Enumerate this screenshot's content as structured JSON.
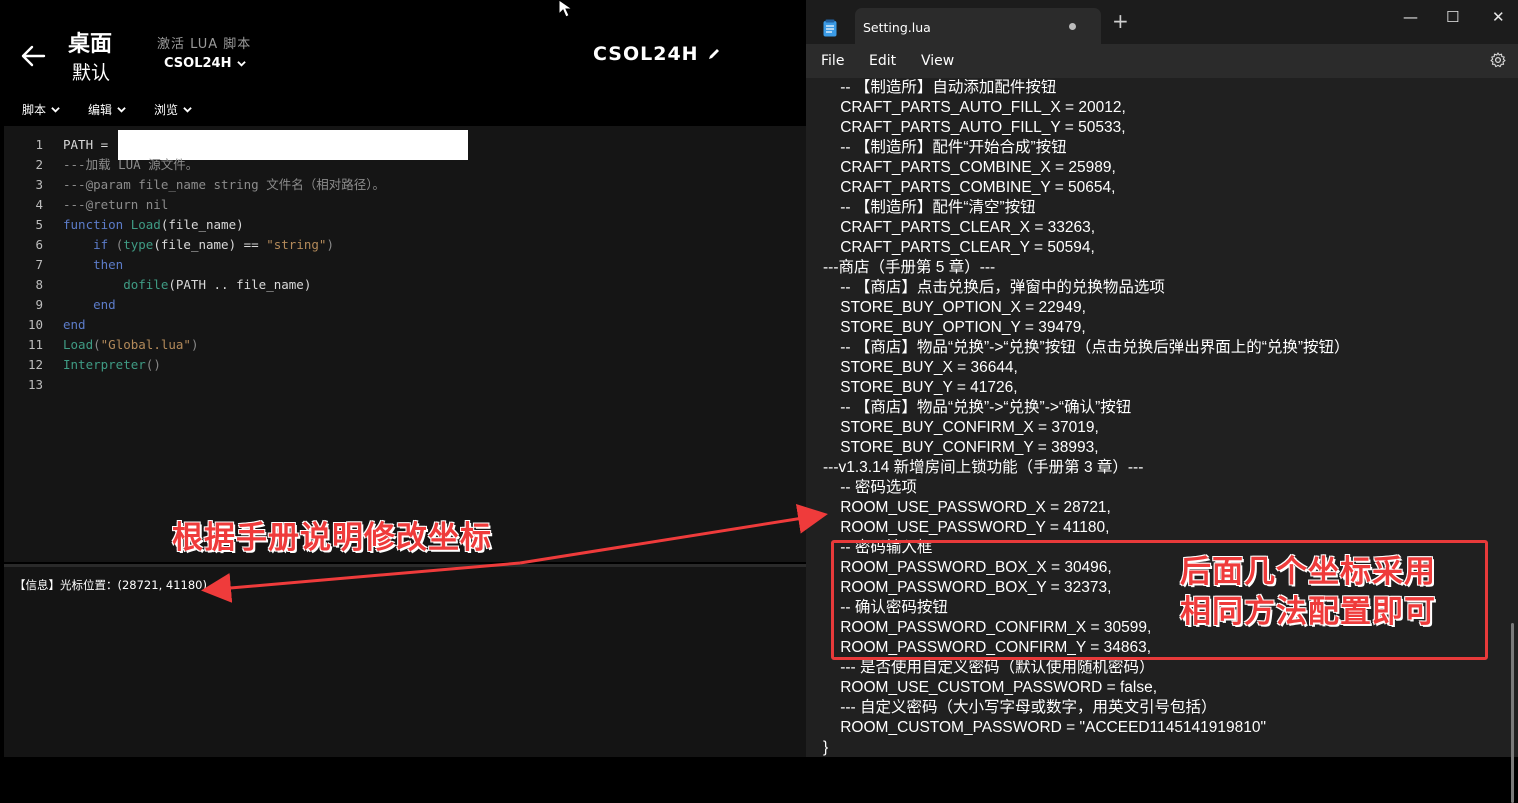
{
  "left_app": {
    "title_main": "桌面",
    "title_sub": "默认",
    "activate_label": "激活 LUA 脚本",
    "script_name": "CSOL24H",
    "center_title": "CSOL24H",
    "menus": [
      "脚本",
      "编辑",
      "浏览"
    ],
    "editor": {
      "line_numbers": [
        "1",
        "2",
        "3",
        "4",
        "5",
        "6",
        "7",
        "8",
        "9",
        "10",
        "11",
        "12",
        "13"
      ],
      "lines": [
        {
          "parts": [
            {
              "t": "PATH = ",
              "c": "plain"
            }
          ]
        },
        {
          "parts": [
            {
              "t": "---加载 LUA 源文件。",
              "c": "cm"
            }
          ]
        },
        {
          "parts": [
            {
              "t": "---@param file_name string 文件名（相对路径）。",
              "c": "cm"
            }
          ]
        },
        {
          "parts": [
            {
              "t": "---@return nil",
              "c": "cm"
            }
          ]
        },
        {
          "parts": [
            {
              "t": "function ",
              "c": "kw"
            },
            {
              "t": "Load",
              "c": "fn"
            },
            {
              "t": "(file_name)",
              "c": "plain"
            }
          ]
        },
        {
          "parts": [
            {
              "t": "    if ",
              "c": "kw"
            },
            {
              "t": "(",
              "c": "dim"
            },
            {
              "t": "type",
              "c": "fn"
            },
            {
              "t": "(file_name) == ",
              "c": "plain"
            },
            {
              "t": "\"string\"",
              "c": "str"
            },
            {
              "t": ")",
              "c": "dim"
            }
          ]
        },
        {
          "parts": [
            {
              "t": "    then",
              "c": "kw"
            }
          ]
        },
        {
          "parts": [
            {
              "t": "        dofile",
              "c": "fn"
            },
            {
              "t": "(PATH .. file_name)",
              "c": "plain"
            }
          ]
        },
        {
          "parts": [
            {
              "t": "    end",
              "c": "kw"
            }
          ]
        },
        {
          "parts": [
            {
              "t": "end",
              "c": "kw"
            }
          ]
        },
        {
          "parts": [
            {
              "t": "Load",
              "c": "fn"
            },
            {
              "t": "(",
              "c": "dim"
            },
            {
              "t": "\"Global.lua\"",
              "c": "str"
            },
            {
              "t": ")",
              "c": "dim"
            }
          ]
        },
        {
          "parts": [
            {
              "t": "Interpreter",
              "c": "fn"
            },
            {
              "t": "()",
              "c": "dim"
            }
          ]
        },
        {
          "parts": [
            {
              "t": "",
              "c": "plain"
            }
          ]
        }
      ]
    },
    "console_text": "【信息】光标位置：(28721, 41180)",
    "annotation": "根据手册说明修改坐标"
  },
  "notepad": {
    "tab_title": "Setting.lua",
    "new_tab": "+",
    "menus": [
      "File",
      "Edit",
      "View"
    ],
    "window_buttons": {
      "minimize": "—",
      "maximize": "☐",
      "close": "✕"
    },
    "lines": [
      "    -- 【制造所】自动添加配件按钮",
      "    CRAFT_PARTS_AUTO_FILL_X = 20012,",
      "    CRAFT_PARTS_AUTO_FILL_Y = 50533,",
      "    -- 【制造所】配件“开始合成”按钮",
      "    CRAFT_PARTS_COMBINE_X = 25989,",
      "    CRAFT_PARTS_COMBINE_Y = 50654,",
      "    -- 【制造所】配件“清空”按钮",
      "    CRAFT_PARTS_CLEAR_X = 33263,",
      "    CRAFT_PARTS_CLEAR_Y = 50594,",
      "---商店（手册第 5 章）---",
      "    -- 【商店】点击兑换后，弹窗中的兑换物品选项",
      "    STORE_BUY_OPTION_X = 22949,",
      "    STORE_BUY_OPTION_Y = 39479,",
      "    -- 【商店】物品“兑换”->“兑换”按钮（点击兑换后弹出界面上的“兑换”按钮）",
      "    STORE_BUY_X = 36644,",
      "    STORE_BUY_Y = 41726,",
      "    -- 【商店】物品“兑换”->“兑换”->“确认”按钮",
      "    STORE_BUY_CONFIRM_X = 37019,",
      "    STORE_BUY_CONFIRM_Y = 38993,",
      "---v1.3.14 新增房间上锁功能（手册第 3 章）---",
      "    -- 密码选项",
      "    ROOM_USE_PASSWORD_X = 28721,",
      "    ROOM_USE_PASSWORD_Y = 41180,",
      "    -- 密码输入框",
      "    ROOM_PASSWORD_BOX_X = 30496,",
      "    ROOM_PASSWORD_BOX_Y = 32373,",
      "    -- 确认密码按钮",
      "    ROOM_PASSWORD_CONFIRM_X = 30599,",
      "    ROOM_PASSWORD_CONFIRM_Y = 34863,",
      "    --- 是否使用自定义密码（默认使用随机密码）",
      "    ROOM_USE_CUSTOM_PASSWORD = false,",
      "    --- 自定义密码（大小写字母或数字，用英文引号包括）",
      "    ROOM_CUSTOM_PASSWORD = \"ACCEED1145141919810\"",
      "}"
    ],
    "annotation_line1": "后面几个坐标采用",
    "annotation_line2": "相同方法配置即可"
  }
}
